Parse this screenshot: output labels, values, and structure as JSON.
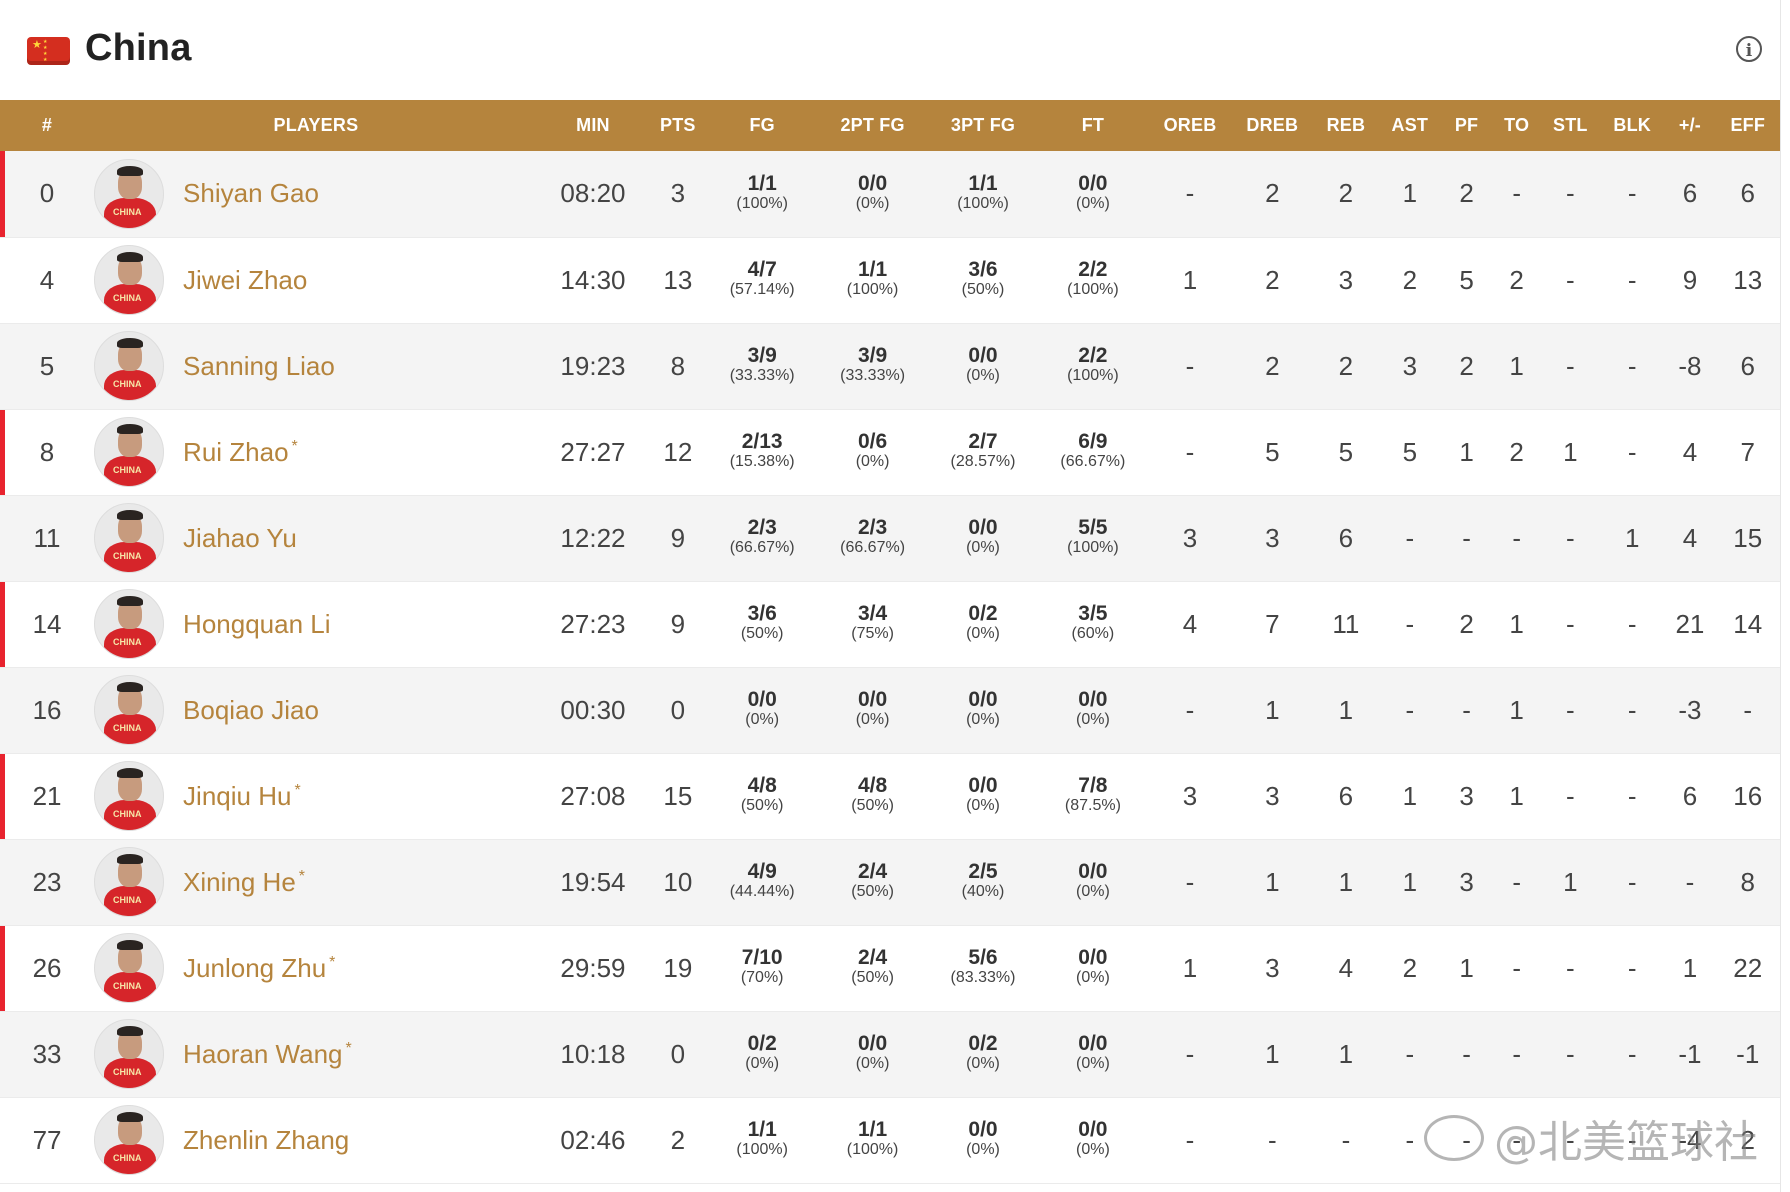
{
  "team": {
    "name": "China",
    "flag_icon": "china-flag-icon",
    "info_icon": "info-icon"
  },
  "colors": {
    "header_bg": "#b5843d",
    "accent": "#b5843d",
    "starter_marker": "#e8232e"
  },
  "columns": [
    "#",
    "PLAYERS",
    "MIN",
    "PTS",
    "FG",
    "2PT FG",
    "3PT FG",
    "FT",
    "OREB",
    "DREB",
    "REB",
    "AST",
    "PF",
    "TO",
    "STL",
    "BLK",
    "+/-",
    "EFF"
  ],
  "players": [
    {
      "num": "0",
      "name": "Shiyan Gao",
      "star": false,
      "starter": true,
      "min": "08:20",
      "pts": "3",
      "fg": "1/1",
      "fg_pct": "(100%)",
      "p2": "0/0",
      "p2_pct": "(0%)",
      "p3": "1/1",
      "p3_pct": "(100%)",
      "ft": "0/0",
      "ft_pct": "(0%)",
      "oreb": "-",
      "dreb": "2",
      "reb": "2",
      "ast": "1",
      "pf": "2",
      "to": "-",
      "stl": "-",
      "blk": "-",
      "pm": "6",
      "eff": "6"
    },
    {
      "num": "4",
      "name": "Jiwei Zhao",
      "star": false,
      "starter": false,
      "min": "14:30",
      "pts": "13",
      "fg": "4/7",
      "fg_pct": "(57.14%)",
      "p2": "1/1",
      "p2_pct": "(100%)",
      "p3": "3/6",
      "p3_pct": "(50%)",
      "ft": "2/2",
      "ft_pct": "(100%)",
      "oreb": "1",
      "dreb": "2",
      "reb": "3",
      "ast": "2",
      "pf": "5",
      "to": "2",
      "stl": "-",
      "blk": "-",
      "pm": "9",
      "eff": "13"
    },
    {
      "num": "5",
      "name": "Sanning Liao",
      "star": false,
      "starter": false,
      "min": "19:23",
      "pts": "8",
      "fg": "3/9",
      "fg_pct": "(33.33%)",
      "p2": "3/9",
      "p2_pct": "(33.33%)",
      "p3": "0/0",
      "p3_pct": "(0%)",
      "ft": "2/2",
      "ft_pct": "(100%)",
      "oreb": "-",
      "dreb": "2",
      "reb": "2",
      "ast": "3",
      "pf": "2",
      "to": "1",
      "stl": "-",
      "blk": "-",
      "pm": "-8",
      "eff": "6"
    },
    {
      "num": "8",
      "name": "Rui Zhao",
      "star": true,
      "starter": true,
      "min": "27:27",
      "pts": "12",
      "fg": "2/13",
      "fg_pct": "(15.38%)",
      "p2": "0/6",
      "p2_pct": "(0%)",
      "p3": "2/7",
      "p3_pct": "(28.57%)",
      "ft": "6/9",
      "ft_pct": "(66.67%)",
      "oreb": "-",
      "dreb": "5",
      "reb": "5",
      "ast": "5",
      "pf": "1",
      "to": "2",
      "stl": "1",
      "blk": "-",
      "pm": "4",
      "eff": "7"
    },
    {
      "num": "11",
      "name": "Jiahao Yu",
      "star": false,
      "starter": false,
      "min": "12:22",
      "pts": "9",
      "fg": "2/3",
      "fg_pct": "(66.67%)",
      "p2": "2/3",
      "p2_pct": "(66.67%)",
      "p3": "0/0",
      "p3_pct": "(0%)",
      "ft": "5/5",
      "ft_pct": "(100%)",
      "oreb": "3",
      "dreb": "3",
      "reb": "6",
      "ast": "-",
      "pf": "-",
      "to": "-",
      "stl": "-",
      "blk": "1",
      "pm": "4",
      "eff": "15"
    },
    {
      "num": "14",
      "name": "Hongquan Li",
      "star": false,
      "starter": true,
      "min": "27:23",
      "pts": "9",
      "fg": "3/6",
      "fg_pct": "(50%)",
      "p2": "3/4",
      "p2_pct": "(75%)",
      "p3": "0/2",
      "p3_pct": "(0%)",
      "ft": "3/5",
      "ft_pct": "(60%)",
      "oreb": "4",
      "dreb": "7",
      "reb": "11",
      "ast": "-",
      "pf": "2",
      "to": "1",
      "stl": "-",
      "blk": "-",
      "pm": "21",
      "eff": "14"
    },
    {
      "num": "16",
      "name": "Boqiao Jiao",
      "star": false,
      "starter": false,
      "min": "00:30",
      "pts": "0",
      "fg": "0/0",
      "fg_pct": "(0%)",
      "p2": "0/0",
      "p2_pct": "(0%)",
      "p3": "0/0",
      "p3_pct": "(0%)",
      "ft": "0/0",
      "ft_pct": "(0%)",
      "oreb": "-",
      "dreb": "1",
      "reb": "1",
      "ast": "-",
      "pf": "-",
      "to": "1",
      "stl": "-",
      "blk": "-",
      "pm": "-3",
      "eff": "-"
    },
    {
      "num": "21",
      "name": "Jinqiu Hu",
      "star": true,
      "starter": true,
      "min": "27:08",
      "pts": "15",
      "fg": "4/8",
      "fg_pct": "(50%)",
      "p2": "4/8",
      "p2_pct": "(50%)",
      "p3": "0/0",
      "p3_pct": "(0%)",
      "ft": "7/8",
      "ft_pct": "(87.5%)",
      "oreb": "3",
      "dreb": "3",
      "reb": "6",
      "ast": "1",
      "pf": "3",
      "to": "1",
      "stl": "-",
      "blk": "-",
      "pm": "6",
      "eff": "16"
    },
    {
      "num": "23",
      "name": "Xining He",
      "star": true,
      "starter": false,
      "min": "19:54",
      "pts": "10",
      "fg": "4/9",
      "fg_pct": "(44.44%)",
      "p2": "2/4",
      "p2_pct": "(50%)",
      "p3": "2/5",
      "p3_pct": "(40%)",
      "ft": "0/0",
      "ft_pct": "(0%)",
      "oreb": "-",
      "dreb": "1",
      "reb": "1",
      "ast": "1",
      "pf": "3",
      "to": "-",
      "stl": "1",
      "blk": "-",
      "pm": "-",
      "eff": "8"
    },
    {
      "num": "26",
      "name": "Junlong Zhu",
      "star": true,
      "starter": true,
      "min": "29:59",
      "pts": "19",
      "fg": "7/10",
      "fg_pct": "(70%)",
      "p2": "2/4",
      "p2_pct": "(50%)",
      "p3": "5/6",
      "p3_pct": "(83.33%)",
      "ft": "0/0",
      "ft_pct": "(0%)",
      "oreb": "1",
      "dreb": "3",
      "reb": "4",
      "ast": "2",
      "pf": "1",
      "to": "-",
      "stl": "-",
      "blk": "-",
      "pm": "1",
      "eff": "22"
    },
    {
      "num": "33",
      "name": "Haoran Wang",
      "star": true,
      "starter": false,
      "min": "10:18",
      "pts": "0",
      "fg": "0/2",
      "fg_pct": "(0%)",
      "p2": "0/0",
      "p2_pct": "(0%)",
      "p3": "0/2",
      "p3_pct": "(0%)",
      "ft": "0/0",
      "ft_pct": "(0%)",
      "oreb": "-",
      "dreb": "1",
      "reb": "1",
      "ast": "-",
      "pf": "-",
      "to": "-",
      "stl": "-",
      "blk": "-",
      "pm": "-1",
      "eff": "-1"
    },
    {
      "num": "77",
      "name": "Zhenlin Zhang",
      "star": false,
      "starter": false,
      "min": "02:46",
      "pts": "2",
      "fg": "1/1",
      "fg_pct": "(100%)",
      "p2": "1/1",
      "p2_pct": "(100%)",
      "p3": "0/0",
      "p3_pct": "(0%)",
      "ft": "0/0",
      "ft_pct": "(0%)",
      "oreb": "-",
      "dreb": "-",
      "reb": "-",
      "ast": "-",
      "pf": "-",
      "to": "-",
      "stl": "-",
      "blk": "-",
      "pm": "-4",
      "eff": "2"
    }
  ],
  "watermark": {
    "text": "@北美篮球社",
    "icon": "weibo-icon"
  }
}
